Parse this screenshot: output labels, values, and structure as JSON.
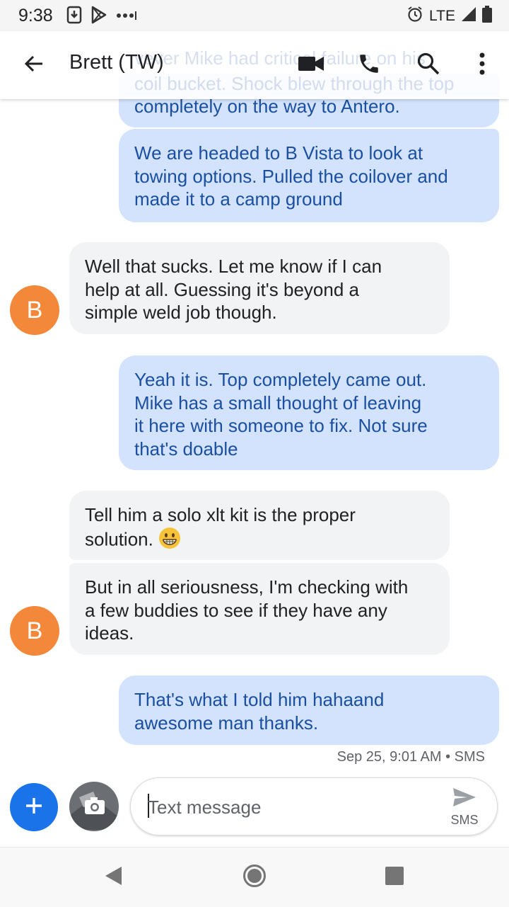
{
  "status_bar": {
    "time": "9:38",
    "network": "LTE",
    "icons_left": [
      "download-icon",
      "play-store-icon",
      "more-dots-icon"
    ],
    "icons_right": [
      "alarm-icon",
      "signal-icon",
      "battery-icon"
    ]
  },
  "app_bar": {
    "title": "Brett (TW)",
    "scrolled_text_behind": [
      "vever Mike had critical failure on his",
      "coil bucket. Shock blew through the top"
    ],
    "actions": [
      "video-call-icon",
      "phone-icon",
      "search-icon",
      "more-vert-icon"
    ]
  },
  "messages": [
    {
      "direction": "out",
      "lines": [
        "completely on the way to Antero."
      ]
    },
    {
      "direction": "out",
      "lines": [
        "We are headed to B Vista to look at",
        "towing options. Pulled the coilover and",
        "made it to a camp ground"
      ]
    },
    {
      "direction": "in",
      "sender_initial": "B",
      "lines": [
        "Well that sucks. Let me know if I can",
        "help at all. Guessing it's beyond a",
        "simple weld job though."
      ]
    },
    {
      "direction": "out",
      "lines": [
        "Yeah it is. Top completely came out.",
        "Mike has a small thought of leaving",
        "it here with someone to fix. Not sure",
        "that's doable"
      ]
    },
    {
      "direction": "in",
      "lines": [
        "Tell him a solo xlt kit is the proper",
        "solution."
      ],
      "emoji": "😁"
    },
    {
      "direction": "in",
      "sender_initial": "B",
      "lines": [
        "But in all seriousness, I'm checking with",
        "a few buddies to see if they have any",
        "ideas."
      ]
    },
    {
      "direction": "out",
      "lines": [
        "That's what I told him hahaand",
        "awesome man thanks."
      ]
    }
  ],
  "timestamp": "Sep 25, 9:01 AM • SMS",
  "composer": {
    "placeholder": "Text message",
    "send_label": "SMS"
  },
  "colors": {
    "outgoing_bubble": "#d3e3fd",
    "outgoing_text": "#1a4fa1",
    "incoming_bubble": "#f1f3f4",
    "avatar": "#f3873a",
    "accent": "#1a73e8"
  }
}
